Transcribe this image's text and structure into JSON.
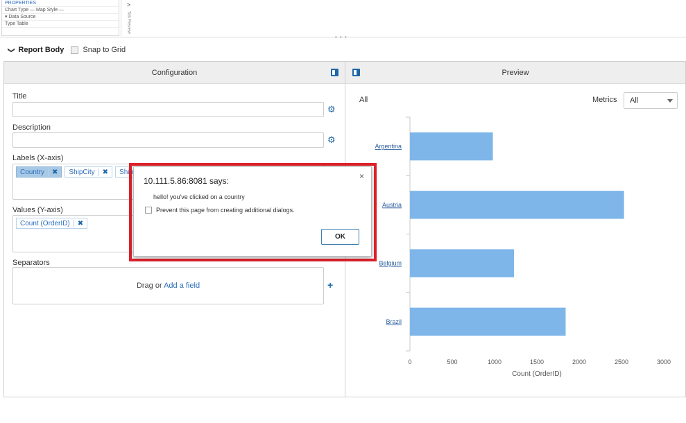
{
  "top_strip": {
    "mini_rows": [
      "PROPERTIES",
      "Chart Type   —   Map Style   —",
      "▾ Data Source",
      "Type          Table"
    ],
    "side_label": "Tab Preview"
  },
  "report_body": {
    "title": "Report Body",
    "snap_label": "Snap to Grid"
  },
  "configuration": {
    "header": "Configuration",
    "title_label": "Title",
    "title_value": "",
    "description_label": "Description",
    "description_value": "",
    "labels_label": "Labels (X-axis)",
    "labels_tags": [
      "Country",
      "ShipCity",
      "ShipCountry"
    ],
    "values_label": "Values (Y-axis)",
    "values_tags": [
      "Count (OrderID)"
    ],
    "separators_label": "Separators",
    "drop_text": "Drag or ",
    "drop_link": "Add a field"
  },
  "preview": {
    "header": "Preview",
    "filter_label": "All",
    "metrics_label": "Metrics",
    "metrics_value": "All"
  },
  "chart_data": {
    "type": "bar",
    "orientation": "horizontal",
    "categories": [
      "Argentina",
      "Austria",
      "Belgium",
      "Brazil"
    ],
    "values": [
      980,
      2530,
      1230,
      1840
    ],
    "xlabel": "Count (OrderID)",
    "ylabel": "",
    "xlim": [
      0,
      3000
    ],
    "x_ticks": [
      0,
      500,
      1000,
      1500,
      2000,
      2500,
      3000
    ],
    "bar_color": "#7eb6ea",
    "grid": false
  },
  "dialog": {
    "title": "10.111.5.86:8081 says:",
    "message": "hello! you've clicked on a country",
    "checkbox_label": "Prevent this page from creating additional dialogs.",
    "ok_label": "OK",
    "close_glyph": "×"
  },
  "icons": {
    "chevron": "❯",
    "gear": "⚙",
    "plus": "+",
    "remove": "✖"
  },
  "colors": {
    "accent": "#1d67a8",
    "highlight": "#e0212b"
  }
}
